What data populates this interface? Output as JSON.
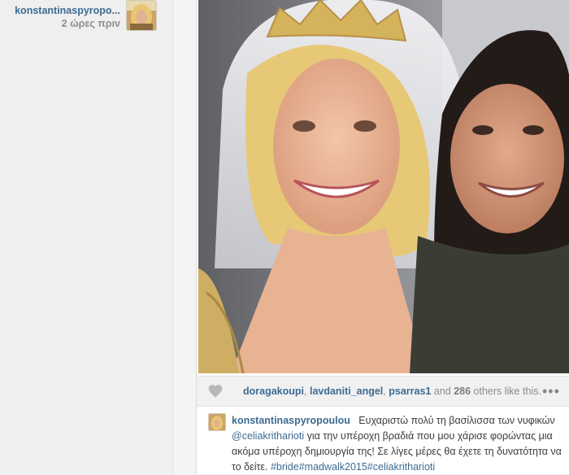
{
  "author": {
    "username": "konstantinaspyropo...",
    "timestamp": "2 ώρες πριν"
  },
  "likes": {
    "users": [
      "doragakoupi",
      "lavdaniti_angel",
      "psarras1"
    ],
    "and_text": "and",
    "count": "286",
    "suffix": "others like this."
  },
  "caption": {
    "username": "konstantinaspyropoulou",
    "text_part1": "Ευχαριστώ πολύ τη βασίλισσα των νυφικών",
    "mention": "@celiakritharioti",
    "text_part2": "για την υπέροχη βραδιά που μου χάρισε φορώντας μια ακόμα υπέροχη δημιουργία της! Σε λίγες μέρες θα έχετε τη δυνατότητα να το δείτε.",
    "hashtags": "#bride#madwalk2015#celiakritharioti"
  },
  "colors": {
    "link": "#3d6b91",
    "muted": "#8d8d8d",
    "bar": "#f1f1f1"
  },
  "icons": {
    "like": "heart-icon",
    "more": "more-dots-icon"
  }
}
